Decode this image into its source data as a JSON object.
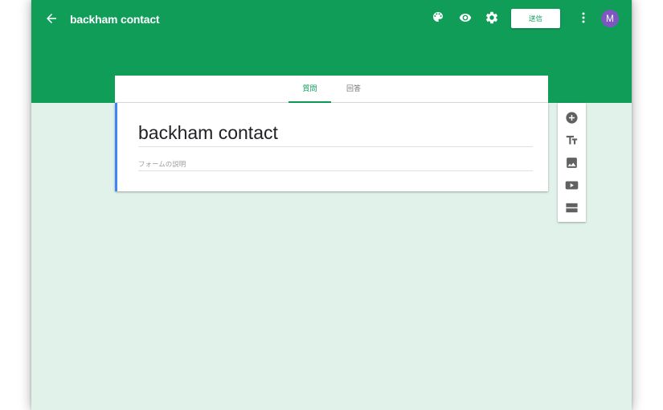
{
  "header": {
    "form_title": "backham contact",
    "send_label": "送信",
    "avatar_initial": "M",
    "color": "#0f9d58"
  },
  "tabs": [
    {
      "label": "質問",
      "active": true
    },
    {
      "label": "回答",
      "active": false
    }
  ],
  "form": {
    "title_value": "backham contact",
    "description_placeholder": "フォームの説明"
  },
  "icons": {
    "back": "arrow-back-icon",
    "theme": "palette-icon",
    "preview": "eye-icon",
    "settings": "gear-icon",
    "more": "more-vert-icon",
    "toolbar": [
      "add-circle-icon",
      "title-text-icon",
      "image-icon",
      "video-icon",
      "section-icon"
    ]
  },
  "colors": {
    "header": "#0f9d58",
    "page_background": "#e0f2ea",
    "accent_bar": "#4285f4",
    "avatar": "#7e57c2"
  }
}
